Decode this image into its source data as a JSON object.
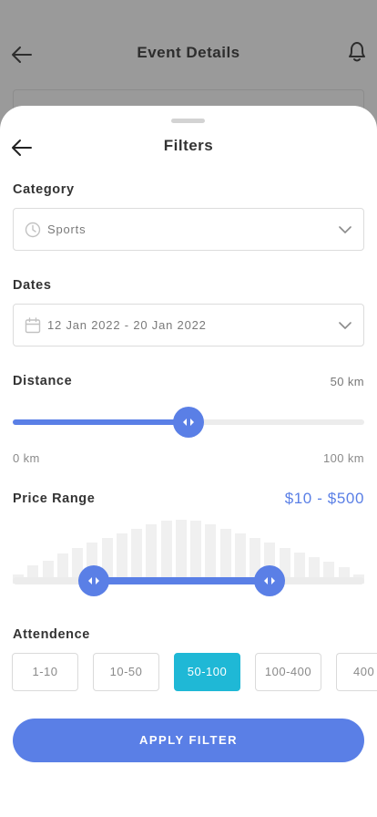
{
  "background": {
    "title": "Event Details"
  },
  "sheet": {
    "title": "Filters"
  },
  "category": {
    "label": "Category",
    "value": "Sports"
  },
  "dates": {
    "label": "Dates",
    "value": "12 Jan 2022 - 20 Jan 2022"
  },
  "distance": {
    "label": "Distance",
    "value_label": "50 km",
    "min_label": "0 km",
    "max_label": "100 km",
    "level": 0.5
  },
  "price": {
    "label": "Price Range",
    "value_label": "$10 - $500",
    "low_level": 0.23,
    "high_level": 0.73,
    "histogram": [
      0.14,
      0.28,
      0.36,
      0.47,
      0.56,
      0.64,
      0.71,
      0.78,
      0.86,
      0.93,
      0.98,
      1.0,
      0.98,
      0.93,
      0.86,
      0.78,
      0.71,
      0.64,
      0.56,
      0.49,
      0.42,
      0.35,
      0.26,
      0.15
    ]
  },
  "attendence": {
    "label": "Attendence",
    "options": [
      "1-10",
      "10-50",
      "50-100",
      "100-400",
      "400"
    ],
    "selected": "50-100"
  },
  "apply_label": "APPLY FILTER",
  "colors": {
    "accent": "#5a7fe6",
    "chip_active": "#1fb8d6"
  }
}
